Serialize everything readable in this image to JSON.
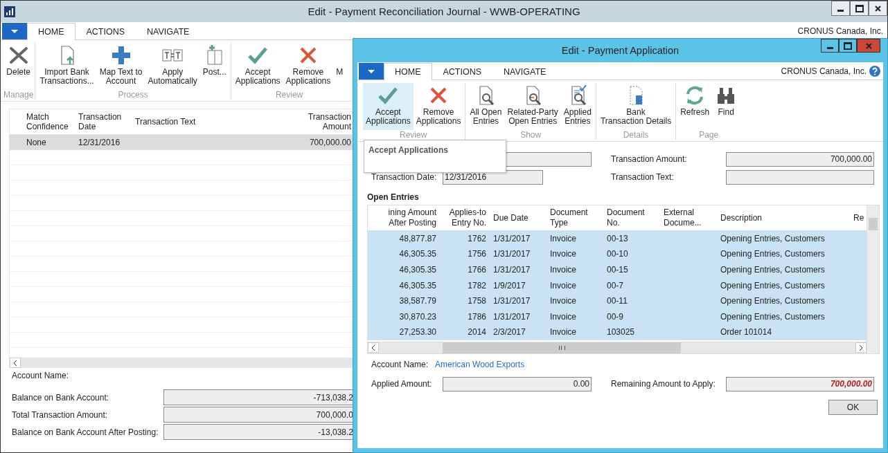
{
  "main": {
    "title": "Edit - Payment Reconciliation Journal - WWB-OPERATING",
    "tabs": [
      {
        "label": "HOME",
        "selected": true
      },
      {
        "label": "ACTIONS",
        "selected": false
      },
      {
        "label": "NAVIGATE",
        "selected": false
      }
    ],
    "company": "CRONUS Canada, Inc.",
    "groups": [
      {
        "label": "Manage",
        "buttons": [
          {
            "label": "Delete"
          }
        ]
      },
      {
        "label": "Process",
        "buttons": [
          {
            "label": "Import Bank\nTransactions..."
          },
          {
            "label": "Map Text to\nAccount"
          },
          {
            "label": "Apply\nAutomatically"
          },
          {
            "label": "Post..."
          }
        ]
      },
      {
        "label": "Review",
        "buttons": [
          {
            "label": "Accept\nApplications"
          },
          {
            "label": "Remove\nApplications"
          },
          {
            "label": "M"
          }
        ]
      }
    ],
    "journal": {
      "columns": [
        "Match\nConfidence",
        "Transaction\nDate",
        "Transaction Text",
        "Transaction\nAmount"
      ],
      "rows": [
        {
          "match_confidence": "None",
          "transaction_date": "12/31/2016",
          "transaction_amount": "700,000.00",
          "selected": true
        }
      ]
    },
    "account_name_label": "Account Name:",
    "totals": [
      {
        "label": "Balance on Bank Account:",
        "value": "-713,038.2"
      },
      {
        "label": "Total Transaction Amount:",
        "value": "700,000.0"
      },
      {
        "label": "Balance on Bank Account After Posting:",
        "value": "-13,038.2"
      }
    ]
  },
  "dialog": {
    "title": "Edit - Payment Application",
    "tabs": [
      {
        "label": "HOME",
        "selected": true
      },
      {
        "label": "ACTIONS",
        "selected": false
      },
      {
        "label": "NAVIGATE",
        "selected": false
      }
    ],
    "company": "CRONUS Canada, Inc.",
    "groups": [
      {
        "label": "Review",
        "buttons": [
          {
            "label": "Accept\nApplications",
            "highlighted": true
          },
          {
            "label": "Remove\nApplications",
            "highlighted": false
          }
        ]
      },
      {
        "label": "Show",
        "buttons": [
          {
            "label": "All Open\nEntries",
            "highlighted": false
          },
          {
            "label": "Related-Party\nOpen Entries",
            "highlighted": false
          },
          {
            "label": "Applied\nEntries",
            "highlighted": false
          }
        ]
      },
      {
        "label": "Details",
        "buttons": [
          {
            "label": "Bank\nTransaction Details",
            "highlighted": false
          }
        ]
      },
      {
        "label": "Page",
        "buttons": [
          {
            "label": "Refresh",
            "highlighted": false
          },
          {
            "label": "Find",
            "highlighted": false
          }
        ]
      }
    ],
    "tooltip": "Accept Applications",
    "transaction_amount": {
      "label": "Transaction Amount:",
      "value": "700,000.00"
    },
    "transaction_date": {
      "label": "Transaction Date:",
      "value": "12/31/2016"
    },
    "transaction_text": {
      "label": "Transaction Text:"
    },
    "section_title": "Open Entries",
    "columns": [
      "ining Amount\nAfter Posting",
      "Applies-to\nEntry No.",
      "Due Date",
      "Document\nType",
      "Document\nNo.",
      "External\nDocume...",
      "Description",
      "Re"
    ],
    "rows": [
      {
        "amount": "48,877.87",
        "entry_no": "1762",
        "due_date": "1/31/2017",
        "doc_type": "Invoice",
        "doc_no": "00-13",
        "description": "Opening Entries, Customers",
        "selected": true
      },
      {
        "amount": "46,305.35",
        "entry_no": "1756",
        "due_date": "1/31/2017",
        "doc_type": "Invoice",
        "doc_no": "00-10",
        "description": "Opening Entries, Customers",
        "selected": true
      },
      {
        "amount": "46,305.35",
        "entry_no": "1766",
        "due_date": "1/31/2017",
        "doc_type": "Invoice",
        "doc_no": "00-15",
        "description": "Opening Entries, Customers",
        "selected": true
      },
      {
        "amount": "46,305.35",
        "entry_no": "1782",
        "due_date": "1/9/2017",
        "doc_type": "Invoice",
        "doc_no": "00-7",
        "description": "Opening Entries, Customers",
        "selected": true
      },
      {
        "amount": "38,587.79",
        "entry_no": "1758",
        "due_date": "1/31/2017",
        "doc_type": "Invoice",
        "doc_no": "00-11",
        "description": "Opening Entries, Customers",
        "selected": true
      },
      {
        "amount": "30,870.23",
        "entry_no": "1786",
        "due_date": "1/31/2017",
        "doc_type": "Invoice",
        "doc_no": "00-9",
        "description": "Opening Entries, Customers",
        "selected": true
      },
      {
        "amount": "27,253.30",
        "entry_no": "2014",
        "due_date": "2/3/2017",
        "doc_type": "Invoice",
        "doc_no": "103025",
        "description": "Order 101014",
        "selected": true
      }
    ],
    "account_name": {
      "label": "Account Name:",
      "value": "American Wood Exports"
    },
    "applied_amount": {
      "label": "Applied Amount:",
      "value": "0.00"
    },
    "remaining_amount": {
      "label": "Remaining Amount to Apply:",
      "value": "700,000.00"
    },
    "ok_button": "OK"
  }
}
